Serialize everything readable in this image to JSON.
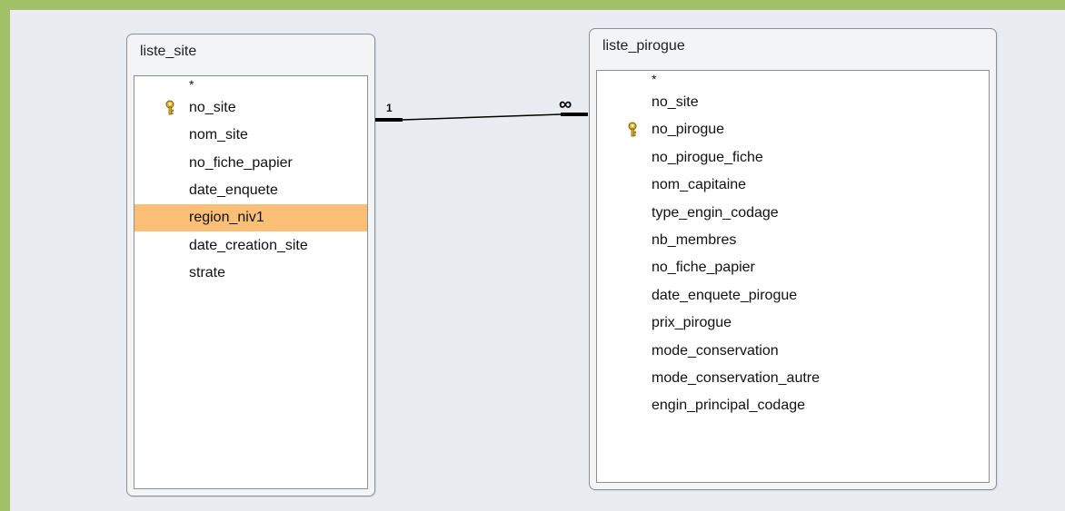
{
  "tables": [
    {
      "title": "liste_site",
      "fields": [
        {
          "label": "*",
          "primary_key": false,
          "selected": false
        },
        {
          "label": "no_site",
          "primary_key": true,
          "selected": false
        },
        {
          "label": "nom_site",
          "primary_key": false,
          "selected": false
        },
        {
          "label": "no_fiche_papier",
          "primary_key": false,
          "selected": false
        },
        {
          "label": "date_enquete",
          "primary_key": false,
          "selected": false
        },
        {
          "label": "region_niv1",
          "primary_key": false,
          "selected": true
        },
        {
          "label": "date_creation_site",
          "primary_key": false,
          "selected": false
        },
        {
          "label": "strate",
          "primary_key": false,
          "selected": false
        }
      ]
    },
    {
      "title": "liste_pirogue",
      "fields": [
        {
          "label": "*",
          "primary_key": false,
          "selected": false
        },
        {
          "label": "no_site",
          "primary_key": false,
          "selected": false
        },
        {
          "label": "no_pirogue",
          "primary_key": true,
          "selected": false
        },
        {
          "label": "no_pirogue_fiche",
          "primary_key": false,
          "selected": false
        },
        {
          "label": "nom_capitaine",
          "primary_key": false,
          "selected": false
        },
        {
          "label": "type_engin_codage",
          "primary_key": false,
          "selected": false
        },
        {
          "label": "nb_membres",
          "primary_key": false,
          "selected": false
        },
        {
          "label": "no_fiche_papier",
          "primary_key": false,
          "selected": false
        },
        {
          "label": "date_enquete_pirogue",
          "primary_key": false,
          "selected": false
        },
        {
          "label": "prix_pirogue",
          "primary_key": false,
          "selected": false
        },
        {
          "label": "mode_conservation",
          "primary_key": false,
          "selected": false
        },
        {
          "label": "mode_conservation_autre",
          "primary_key": false,
          "selected": false
        },
        {
          "label": "engin_principal_codage",
          "primary_key": false,
          "selected": false
        }
      ]
    }
  ],
  "relationship": {
    "one_side_label": "1",
    "many_side_label": "∞"
  },
  "colors": {
    "frame": "#a3c166",
    "canvas": "#e9edf2",
    "selected_row": "#fbbf78",
    "key_icon": "#e6b422"
  },
  "icons": {
    "primary_key": "key-icon"
  }
}
